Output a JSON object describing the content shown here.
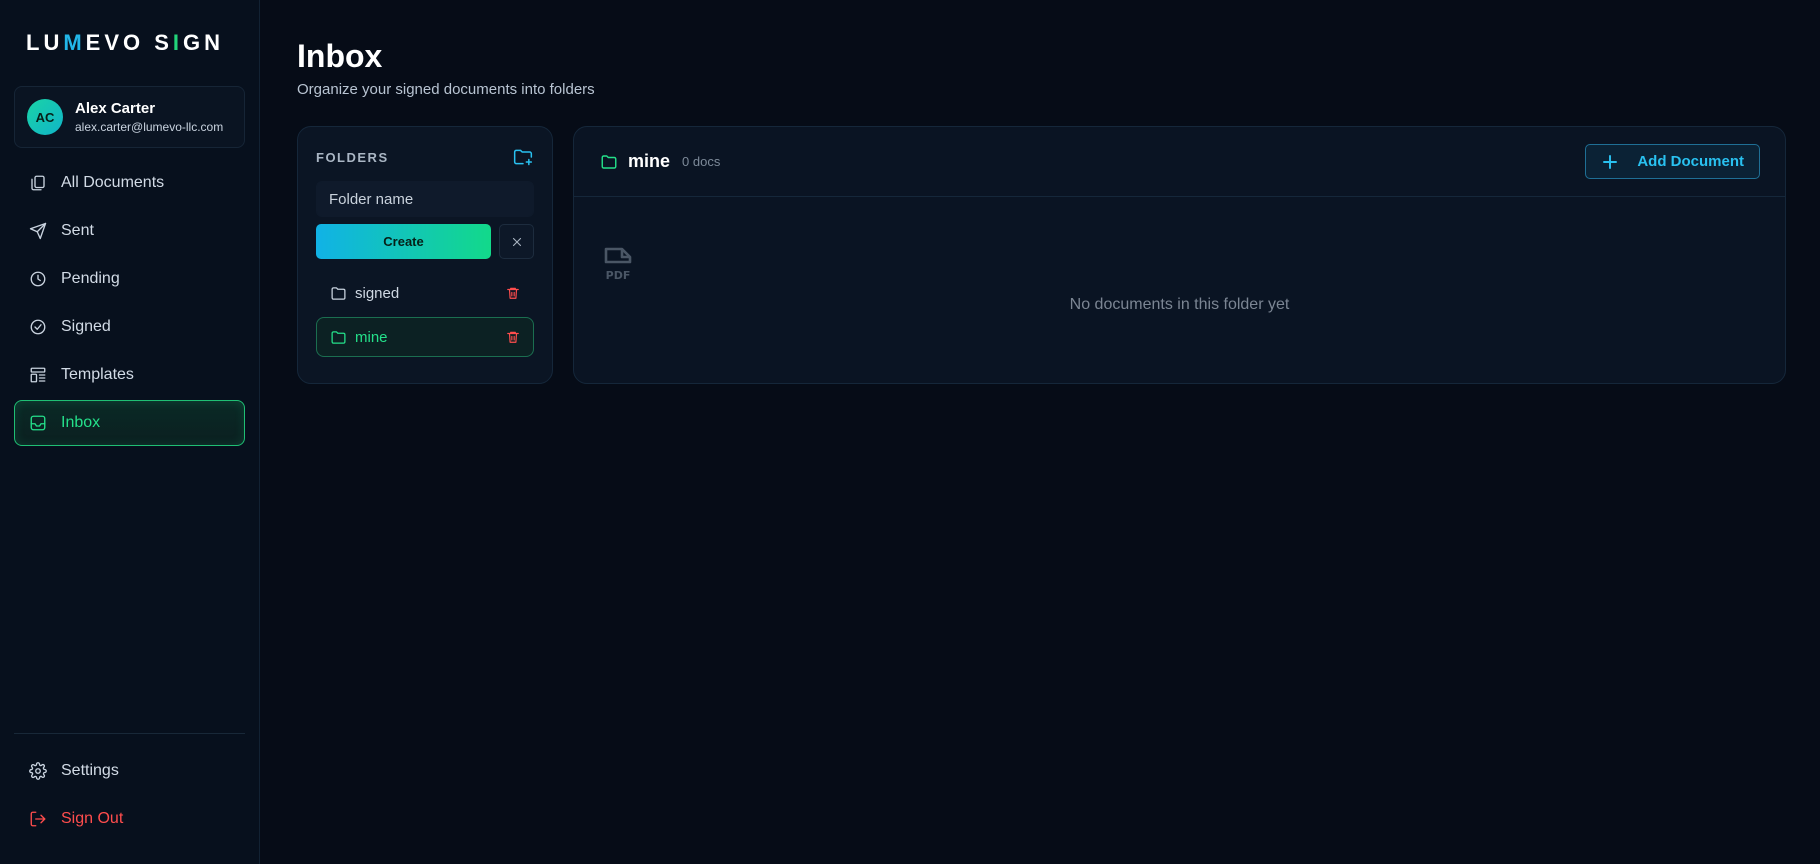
{
  "brand": {
    "part1": "LU",
    "accent1": "M",
    "part2": "EVO S",
    "accent2": "I",
    "part3": "GN"
  },
  "user": {
    "initials": "AC",
    "name": "Alex Carter",
    "email": "alex.carter@lumevo-llc.com"
  },
  "nav": {
    "items": [
      {
        "label": "All Documents",
        "icon": "documents-icon"
      },
      {
        "label": "Sent",
        "icon": "send-icon"
      },
      {
        "label": "Pending",
        "icon": "clock-icon"
      },
      {
        "label": "Signed",
        "icon": "check-circle-icon"
      },
      {
        "label": "Templates",
        "icon": "template-icon"
      },
      {
        "label": "Inbox",
        "icon": "inbox-icon",
        "active": true
      }
    ],
    "settings": "Settings",
    "signout": "Sign Out"
  },
  "page": {
    "title": "Inbox",
    "subtitle": "Organize your signed documents into folders"
  },
  "folders": {
    "label": "FOLDERS",
    "input_placeholder": "Folder name",
    "create_label": "Create",
    "items": [
      {
        "name": "signed",
        "active": false
      },
      {
        "name": "mine",
        "active": true
      }
    ]
  },
  "documents": {
    "folder_name": "mine",
    "count": "0 docs",
    "add_label": "Add Document",
    "empty_text": "No documents in this folder yet"
  },
  "colors": {
    "background": "#060c17",
    "accent_green": "#24e08a",
    "accent_blue": "#29c1f0",
    "danger": "#ff4d4d"
  }
}
